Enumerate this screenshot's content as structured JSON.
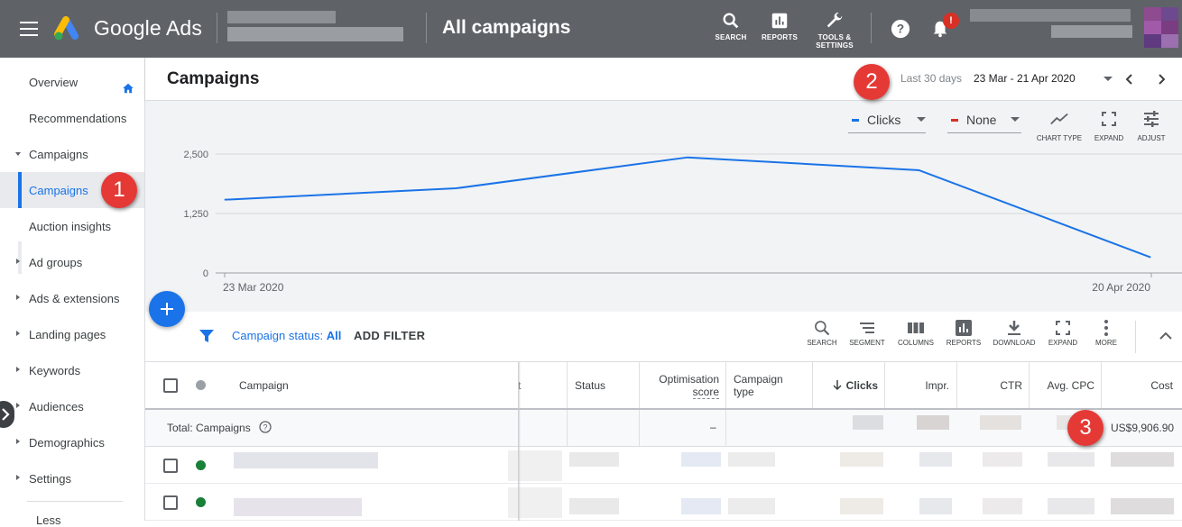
{
  "app": {
    "brand": "Google Ads",
    "page_heading": "All campaigns"
  },
  "topbar_tools": [
    {
      "icon": "search-icon",
      "label": "SEARCH"
    },
    {
      "icon": "reports-icon",
      "label": "REPORTS"
    },
    {
      "icon": "wrench-icon",
      "label": "TOOLS &",
      "label2": "SETTINGS"
    }
  ],
  "notification_badge": "!",
  "sidebar": {
    "items": [
      {
        "label": "Overview"
      },
      {
        "label": "Recommendations"
      },
      {
        "label": "Campaigns"
      },
      {
        "label": "Campaigns"
      },
      {
        "label": "Auction insights"
      },
      {
        "label": "Ad groups"
      },
      {
        "label": "Ads & extensions"
      },
      {
        "label": "Landing pages"
      },
      {
        "label": "Keywords"
      },
      {
        "label": "Audiences"
      },
      {
        "label": "Demographics"
      },
      {
        "label": "Settings"
      }
    ],
    "more_label": "Less"
  },
  "markers": [
    "1",
    "2",
    "3"
  ],
  "header": {
    "title": "Campaigns",
    "range_label": "Last 30 days",
    "range_value": "23 Mar - 21 Apr 2020"
  },
  "chart_controls": {
    "metric1": "Clicks",
    "metric2": "None",
    "tools": [
      "CHART TYPE",
      "EXPAND",
      "ADJUST"
    ],
    "colors": {
      "metric1": "#1a73e8",
      "metric2": "#d93025"
    }
  },
  "chart_data": {
    "type": "line",
    "series": [
      {
        "name": "Clicks",
        "x": [
          "23 Mar 2020",
          "30 Mar 2020",
          "6 Apr 2020",
          "13 Apr 2020",
          "20 Apr 2020"
        ],
        "values": [
          1540,
          1780,
          2430,
          2160,
          330
        ]
      }
    ],
    "x_tick_labels": [
      "23 Mar 2020",
      "20 Apr 2020"
    ],
    "y_ticks": [
      "2,500",
      "1,250",
      "0"
    ],
    "ylim": [
      0,
      2500
    ],
    "grid": true,
    "color": "#1a73e8"
  },
  "filter_bar": {
    "status_prefix": "Campaign status: ",
    "status_value": "All",
    "add_filter": "ADD FILTER",
    "tools": [
      "SEARCH",
      "SEGMENT",
      "COLUMNS",
      "REPORTS",
      "DOWNLOAD",
      "EXPAND",
      "MORE"
    ]
  },
  "table": {
    "headers": {
      "campaign": "Campaign",
      "budget_fragment": "t",
      "status": "Status",
      "opt_score_1": "Optimisation",
      "opt_score_2": "score",
      "type_1": "Campaign",
      "type_2": "type",
      "clicks": "Clicks",
      "impr": "Impr.",
      "ctr": "CTR",
      "avg_cpc": "Avg. CPC",
      "cost": "Cost"
    },
    "total": {
      "label": "Total: Campaigns",
      "opt_score": "–",
      "cost": "US$9,906.90"
    },
    "status_color": "#188038"
  }
}
